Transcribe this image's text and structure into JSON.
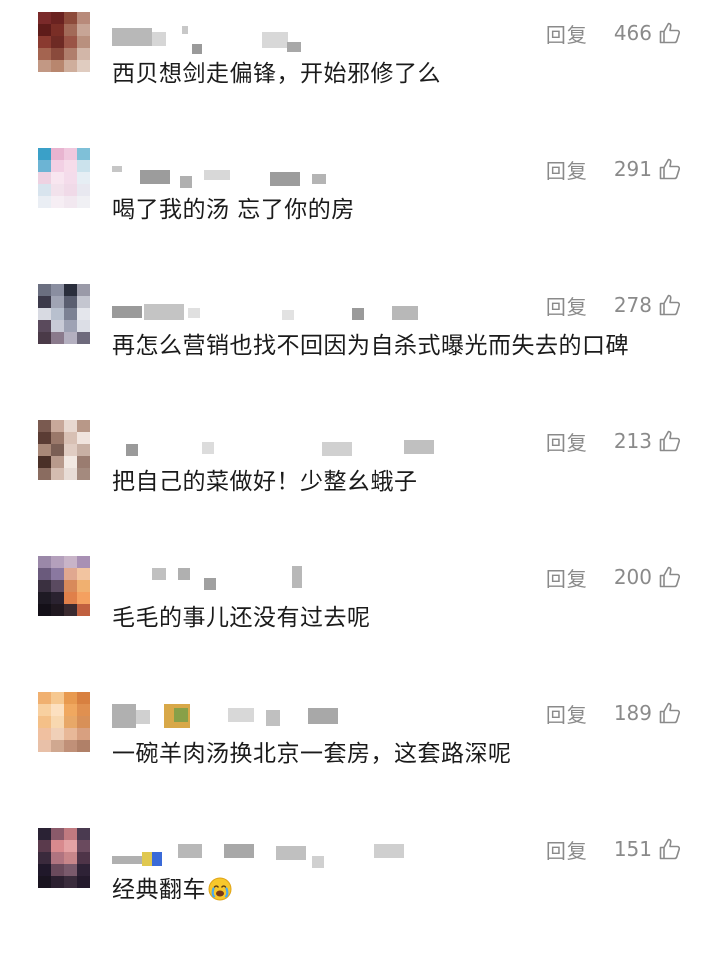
{
  "reply_label": "回复",
  "comments": [
    {
      "text": "西贝想剑走偏锋，开始邪修了么",
      "likes": "466",
      "avatar_colors": [
        "#7a2a2a",
        "#6a2220",
        "#8c4a3a",
        "#b88a7a",
        "#5e1c1a",
        "#7a2e26",
        "#a26a58",
        "#c7a596",
        "#8a3a30",
        "#6e2a24",
        "#9a5446",
        "#b9907e",
        "#a46450",
        "#8a4a3c",
        "#b07e6c",
        "#d2b6a8",
        "#c29884",
        "#b8866e",
        "#cfae9c",
        "#e0ccc0"
      ]
    },
    {
      "text": "喝了我的汤 忘了你的房",
      "likes": "291",
      "avatar_colors": [
        "#3aa0c8",
        "#e8b4d0",
        "#f0c8de",
        "#7fc0d8",
        "#6cb4d4",
        "#f2d0e4",
        "#f6dcea",
        "#cbe2ec",
        "#eed2e2",
        "#f8e6f0",
        "#f4dceb",
        "#e6eef4",
        "#d8e4ee",
        "#f2e2ec",
        "#f0dae8",
        "#e8e8f0",
        "#eaeef4",
        "#f6eef4",
        "#f2e8f0",
        "#f0f0f4"
      ]
    },
    {
      "text": "再怎么营销也找不回因为自杀式曝光而失去的口碑",
      "likes": "278",
      "avatar_colors": [
        "#6b6f80",
        "#8a8ea0",
        "#2a2e3c",
        "#9a9aa8",
        "#3c3a4a",
        "#a0a4b4",
        "#5a5e70",
        "#c4c6d0",
        "#d8dae2",
        "#b8c0ce",
        "#7c8294",
        "#e4e6ec",
        "#5a4a5c",
        "#c8cad6",
        "#9ea2b4",
        "#dcdee6",
        "#4a3a48",
        "#8a7a8c",
        "#b4b0c0",
        "#6e6a7c"
      ]
    },
    {
      "text": "把自己的菜做好！少整幺蛾子",
      "likes": "213",
      "avatar_colors": [
        "#7a5a50",
        "#c8a89a",
        "#e8d8d0",
        "#b89888",
        "#5a3c34",
        "#9a786a",
        "#d8c0b4",
        "#f0e4de",
        "#a88878",
        "#7a5e54",
        "#e0ccc2",
        "#c8b0a4",
        "#4a3028",
        "#b89a8c",
        "#f2e8e2",
        "#9a7c70",
        "#8a6c60",
        "#d4bcb0",
        "#e8dcd6",
        "#a48a7e"
      ]
    },
    {
      "text": "毛毛的事儿还没有过去呢",
      "likes": "200",
      "avatar_colors": [
        "#9a88a8",
        "#b4a0bc",
        "#c8b4c8",
        "#a890b4",
        "#6a5a7c",
        "#8a78a0",
        "#e0a890",
        "#f2c4a0",
        "#3a3040",
        "#5a4a60",
        "#d88a5a",
        "#f0b070",
        "#1e1a24",
        "#2a2230",
        "#e0804a",
        "#f4a060",
        "#141018",
        "#201820",
        "#3a2a30",
        "#c06040"
      ]
    },
    {
      "text": "一碗羊肉汤换北京一套房，这套路深呢",
      "likes": "189",
      "avatar_colors": [
        "#f0b070",
        "#f6c890",
        "#e89a50",
        "#d88040",
        "#f8d0a0",
        "#fce0c0",
        "#f0a860",
        "#e09050",
        "#f4c088",
        "#f8d8b0",
        "#e8a868",
        "#d89058",
        "#f0c0a0",
        "#f0d0b8",
        "#e8b898",
        "#d8a080",
        "#e8c0a8",
        "#d0a890",
        "#c09078",
        "#b08068"
      ]
    },
    {
      "text": "经典翻车",
      "likes": "151",
      "avatar_colors": [
        "#2a2234",
        "#8a5a6a",
        "#c07a80",
        "#4a3a50",
        "#5a3a4c",
        "#d88a8e",
        "#e4a2a4",
        "#6a4a5e",
        "#3a2a3c",
        "#b07480",
        "#c8868a",
        "#4e3448",
        "#20182a",
        "#6a4a5c",
        "#7a5a6c",
        "#2e2236",
        "#1a1420",
        "#2c2030",
        "#3a2c3c",
        "#241a2c"
      ]
    }
  ]
}
